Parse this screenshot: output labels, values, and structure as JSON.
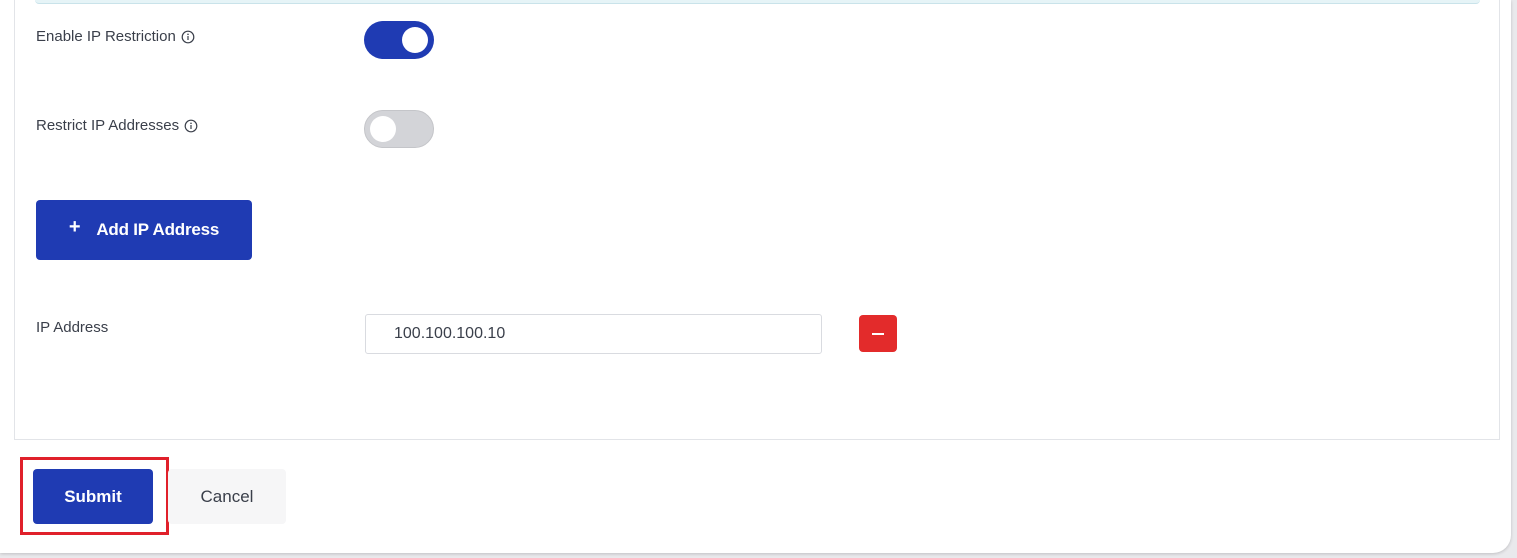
{
  "settings": {
    "enable_ip_restriction": {
      "label": "Enable IP Restriction",
      "enabled": true
    },
    "restrict_ip_addresses": {
      "label": "Restrict IP Addresses",
      "enabled": false
    }
  },
  "add_ip_button": {
    "label": "Add IP Address",
    "icon": "plus-icon"
  },
  "ip_entries": [
    {
      "label": "IP Address",
      "value": "100.100.100.10"
    }
  ],
  "footer": {
    "submit_label": "Submit",
    "cancel_label": "Cancel"
  },
  "colors": {
    "primary": "#1f3bb3",
    "danger": "#e32b2b",
    "highlight": "#e0202a"
  }
}
